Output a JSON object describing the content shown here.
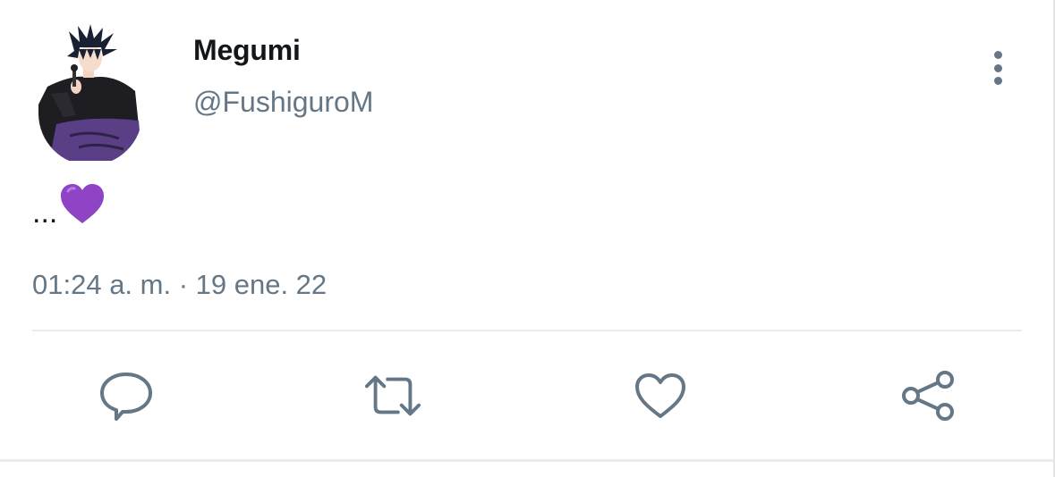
{
  "tweet": {
    "display_name": "Megumi",
    "handle": "@FushiguroM",
    "text_prefix": "...",
    "text_emoji": "purple-heart",
    "timestamp": "01:24 a. m. · 19 ene. 22"
  },
  "actions": [
    {
      "name": "reply",
      "icon": "comment-icon"
    },
    {
      "name": "retweet",
      "icon": "retweet-icon"
    },
    {
      "name": "like",
      "icon": "heart-outline-icon"
    },
    {
      "name": "share",
      "icon": "share-icon"
    }
  ],
  "colors": {
    "primary_text": "#14171a",
    "secondary_text": "#657786",
    "divider": "#e6ecf0",
    "emoji_purple": "#8e44c4"
  }
}
